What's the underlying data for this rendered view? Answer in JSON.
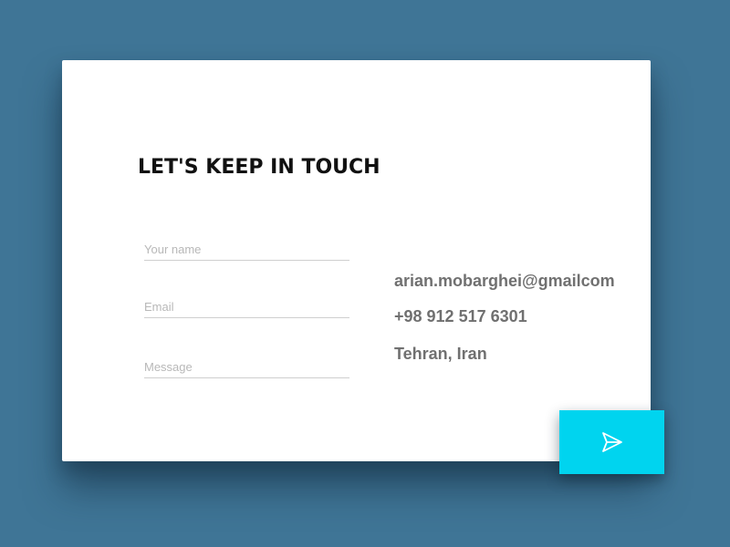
{
  "heading": "LET'S KEEP IN TOUCH",
  "form": {
    "name_placeholder": "Your name",
    "email_placeholder": "Email",
    "message_placeholder": "Message"
  },
  "contact": {
    "email": "arian.mobarghei@gmailcom",
    "phone": "+98 912 517 6301",
    "location": "Tehran, Iran"
  },
  "send_button": {
    "icon": "send-icon"
  },
  "colors": {
    "background": "#3f7596",
    "card": "#ffffff",
    "accent": "#00d4ef",
    "contact_text": "#707070",
    "heading_text": "#111111"
  }
}
